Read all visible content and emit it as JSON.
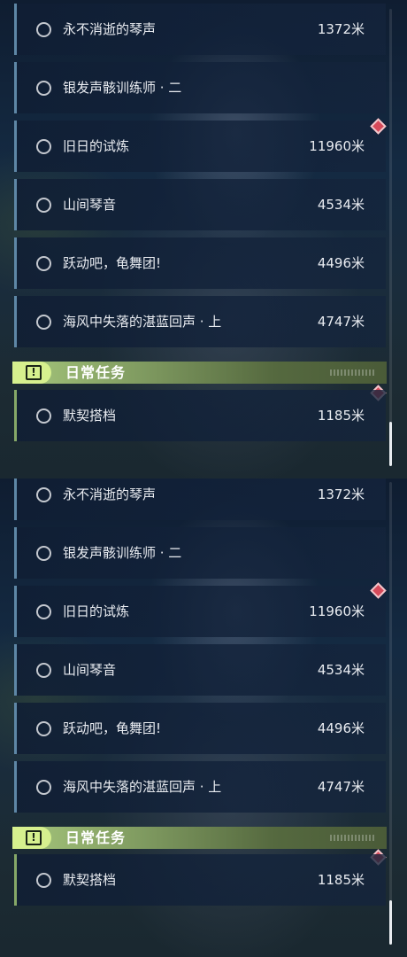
{
  "panels": [
    {
      "quests": [
        {
          "name": "永不消逝的琴声",
          "distance": "1372米"
        },
        {
          "name": "银发声骸训练师 · 二",
          "distance": ""
        },
        {
          "name": "旧日的试炼",
          "distance": "11960米"
        },
        {
          "name": "山间琴音",
          "distance": "4534米"
        },
        {
          "name": "跃动吧，龟舞团!",
          "distance": "4496米"
        },
        {
          "name": "海风中失落的湛蓝回声 · 上",
          "distance": "4747米"
        }
      ],
      "section": {
        "title": "日常任务",
        "icon": "exclamation-icon"
      },
      "daily": [
        {
          "name": "默契搭档",
          "distance": "1185米"
        }
      ]
    },
    {
      "quests": [
        {
          "name": "永不消逝的琴声",
          "distance": "1372米"
        },
        {
          "name": "银发声骸训练师 · 二",
          "distance": ""
        },
        {
          "name": "旧日的试炼",
          "distance": "11960米"
        },
        {
          "name": "山间琴音",
          "distance": "4534米"
        },
        {
          "name": "跃动吧，龟舞团!",
          "distance": "4496米"
        },
        {
          "name": "海风中失落的湛蓝回声 · 上",
          "distance": "4747米"
        }
      ],
      "section": {
        "title": "日常任务",
        "icon": "exclamation-icon"
      },
      "daily": [
        {
          "name": "默契搭档",
          "distance": "1185米"
        }
      ]
    }
  ],
  "colors": {
    "marker": "#d64a5a",
    "section_accent": "#d6f08e",
    "quest_border": "#5e87a6"
  }
}
